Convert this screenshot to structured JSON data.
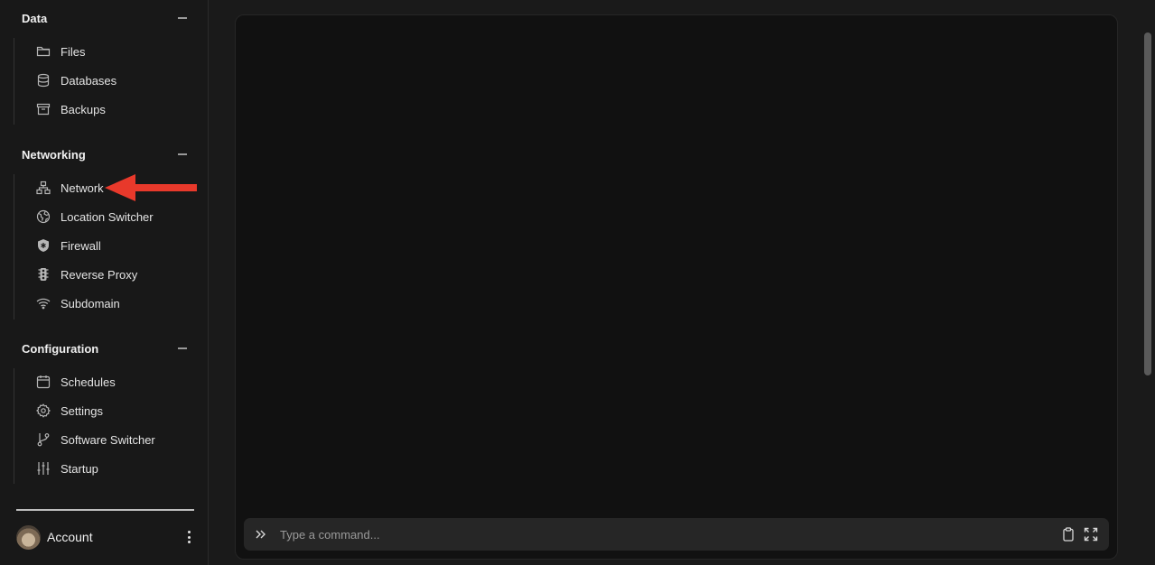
{
  "sidebar": {
    "sections": [
      {
        "title": "Data",
        "items": [
          {
            "label": "Files",
            "icon": "folder-icon"
          },
          {
            "label": "Databases",
            "icon": "database-icon"
          },
          {
            "label": "Backups",
            "icon": "archive-icon"
          }
        ]
      },
      {
        "title": "Networking",
        "items": [
          {
            "label": "Network",
            "icon": "network-icon"
          },
          {
            "label": "Location Switcher",
            "icon": "globe-icon"
          },
          {
            "label": "Firewall",
            "icon": "shield-icon"
          },
          {
            "label": "Reverse Proxy",
            "icon": "traffic-light-icon"
          },
          {
            "label": "Subdomain",
            "icon": "wifi-icon"
          }
        ]
      },
      {
        "title": "Configuration",
        "items": [
          {
            "label": "Schedules",
            "icon": "calendar-icon"
          },
          {
            "label": "Settings",
            "icon": "gear-icon"
          },
          {
            "label": "Software Switcher",
            "icon": "git-branch-icon"
          },
          {
            "label": "Startup",
            "icon": "sliders-icon"
          }
        ]
      }
    ],
    "account": {
      "label": "Account"
    }
  },
  "annotation": {
    "color": "#e8392b"
  },
  "console": {
    "command_placeholder": "Type a command..."
  }
}
